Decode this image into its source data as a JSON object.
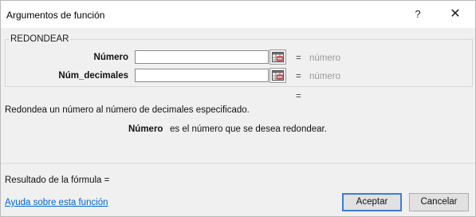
{
  "dialog": {
    "title": "Argumentos de función",
    "help_glyph": "?",
    "close_glyph": "✕"
  },
  "function_group": {
    "name": "REDONDEAR",
    "args": [
      {
        "label": "Número",
        "value": "",
        "equals": "=",
        "hint": "número"
      },
      {
        "label": "Núm_decimales",
        "value": "",
        "equals": "=",
        "hint": "número"
      }
    ],
    "result_equals": "="
  },
  "description": "Redondea un número al número de decimales especificado.",
  "arg_help": {
    "name": "Número",
    "text": "es el número que se desea redondear."
  },
  "formula_result_label": "Resultado de la fórmula =",
  "help_link": "Ayuda sobre esta función",
  "buttons": {
    "ok": "Aceptar",
    "cancel": "Cancelar"
  },
  "icons": {
    "range_selector": "range-select-icon"
  },
  "colors": {
    "accent": "#3c7fd1",
    "link": "#0066cc",
    "hint": "#9a9a9a",
    "dialog_bg": "#f0f0f0"
  }
}
